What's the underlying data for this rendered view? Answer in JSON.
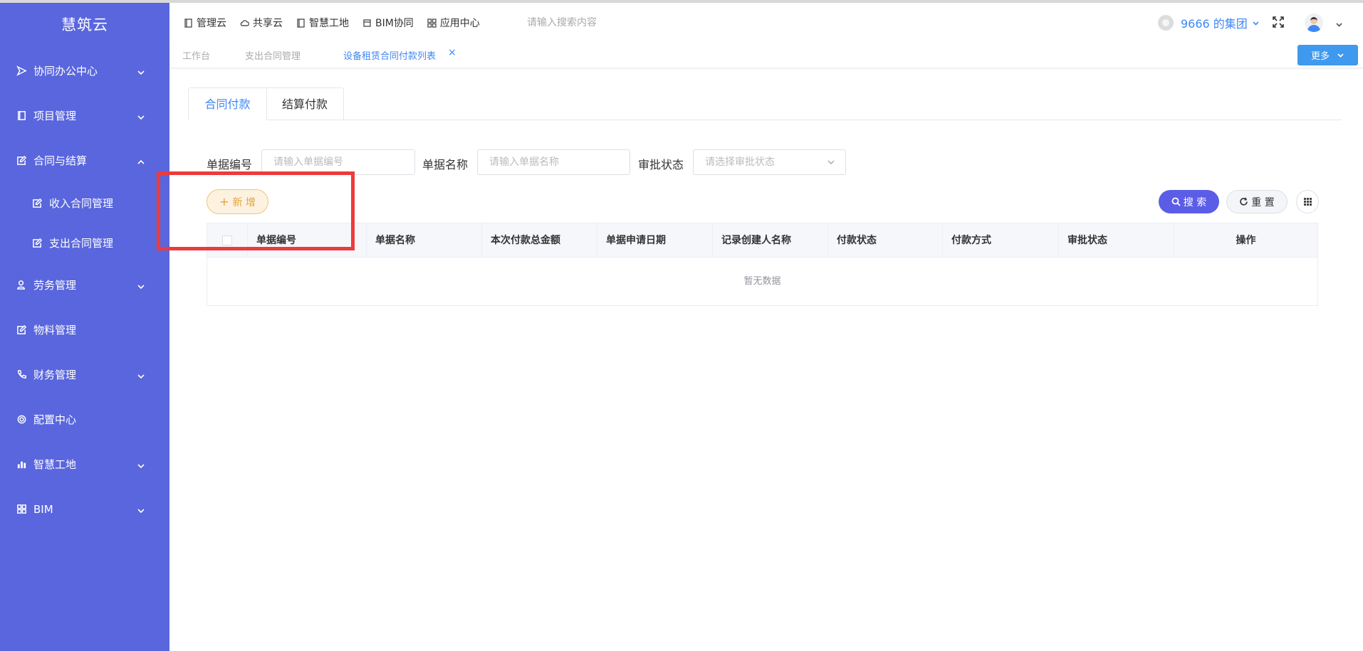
{
  "sidebar": {
    "brand": "慧筑云",
    "items": [
      {
        "label": "协同办公中心",
        "icon": "send-icon",
        "expandable": true
      },
      {
        "label": "项目管理",
        "icon": "book-icon",
        "expandable": true
      },
      {
        "label": "合同与结算",
        "icon": "edit-icon",
        "expandable": true,
        "expanded": true
      },
      {
        "label": "收入合同管理",
        "icon": "edit-icon",
        "sub": true
      },
      {
        "label": "支出合同管理",
        "icon": "edit-icon",
        "sub": true
      },
      {
        "label": "劳务管理",
        "icon": "worker-icon",
        "expandable": true
      },
      {
        "label": "物料管理",
        "icon": "edit-icon",
        "expandable": false
      },
      {
        "label": "财务管理",
        "icon": "phone-icon",
        "expandable": true
      },
      {
        "label": "配置中心",
        "icon": "gear-icon",
        "expandable": false
      },
      {
        "label": "智慧工地",
        "icon": "bar-chart-icon",
        "expandable": true
      },
      {
        "label": "BIM",
        "icon": "grid-icon",
        "expandable": true
      }
    ]
  },
  "header": {
    "nav": [
      "管理云",
      "共享云",
      "智慧工地",
      "BIM协同",
      "应用中心"
    ],
    "search_placeholder": "请输入搜索内容",
    "org_name": "9666 的集团"
  },
  "tagbar": {
    "tags": [
      "工作台",
      "支出合同管理",
      "设备租赁合同付款列表"
    ],
    "close_glyph": "×",
    "more_label": "更多"
  },
  "main": {
    "tabs": [
      "合同付款",
      "结算付款"
    ],
    "filters": [
      {
        "label": "单据编号",
        "placeholder": "请输入单据编号"
      },
      {
        "label": "单据名称",
        "placeholder": "请输入单据名称"
      },
      {
        "label": "审批状态",
        "placeholder": "请选择审批状态"
      }
    ],
    "add_label": "新 增",
    "add_glyph": "+",
    "search_label": "搜 索",
    "reset_label": "重 置",
    "columns": [
      "单据编号",
      "单据名称",
      "本次付款总金额",
      "单据申请日期",
      "记录创建人名称",
      "付款状态",
      "付款方式",
      "审批状态",
      "操作"
    ],
    "empty_text": "暂无数据"
  },
  "colors": {
    "sidebar_bg": "#5966dd",
    "accent": "#3f87f5",
    "search_btn": "#5b5de6",
    "add_btn_text": "#e3a33c",
    "highlight": "#ec3b3b"
  }
}
